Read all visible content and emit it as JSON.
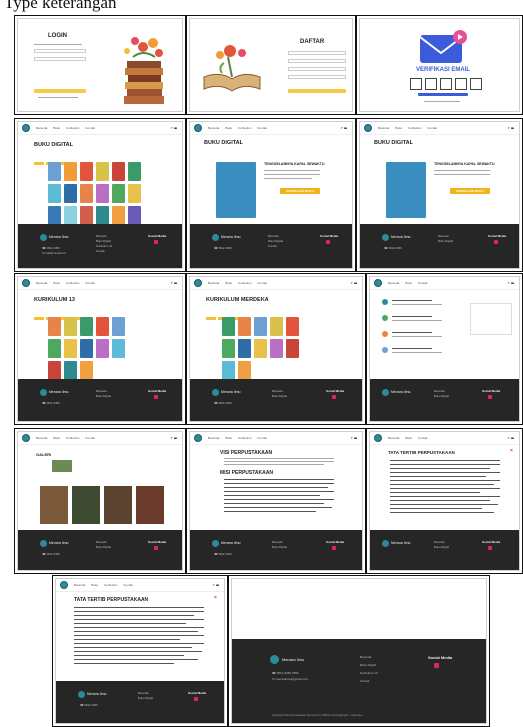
{
  "caption": "Type keterangan",
  "auth": {
    "login_title": "LOGIN",
    "daftar_title": "DAFTAR",
    "verify_title": "VERIFIKASI EMAIL"
  },
  "nav": {
    "links": [
      "Beranda",
      "Buku Digital",
      "Kurikulum Merdeka",
      "Kontak",
      "Profil"
    ]
  },
  "pages": {
    "buku_digital_title": "BUKU DIGITAL",
    "book_detail_title": "TENGGELAMNYA KAPAL SEWAKTU",
    "download_label": "DOWNLOAD BUKU",
    "kurikulum13_title": "KURIKULUM 13",
    "kurikulum_merdeka_title": "KURIKULUM MERDEKA",
    "galeri_title": "GALERI",
    "visi_title": "VISI PERPUSTAKAAN",
    "misi_title": "MISI PERPUSTAKAAN",
    "tata_tertib_title": "TATA TERTIB PERPUSTAKAAN"
  },
  "footer": {
    "brand": "Menara Ilmu",
    "social": "Social Media",
    "copyright": "Copyright 2024 Perpustakaan Menara Ilmu SMKN 1 Karangampel - Indramayu",
    "menu": [
      "Beranda",
      "Buku Digital",
      "Kurikulum 13",
      "Kontak"
    ]
  },
  "colors": {
    "accent_yellow": "#f2b318",
    "footer_dark": "#262626",
    "teal_logo": "#2d8a9a",
    "verify_blue": "#3b5bd8",
    "verify_pink": "#e84d9a"
  }
}
